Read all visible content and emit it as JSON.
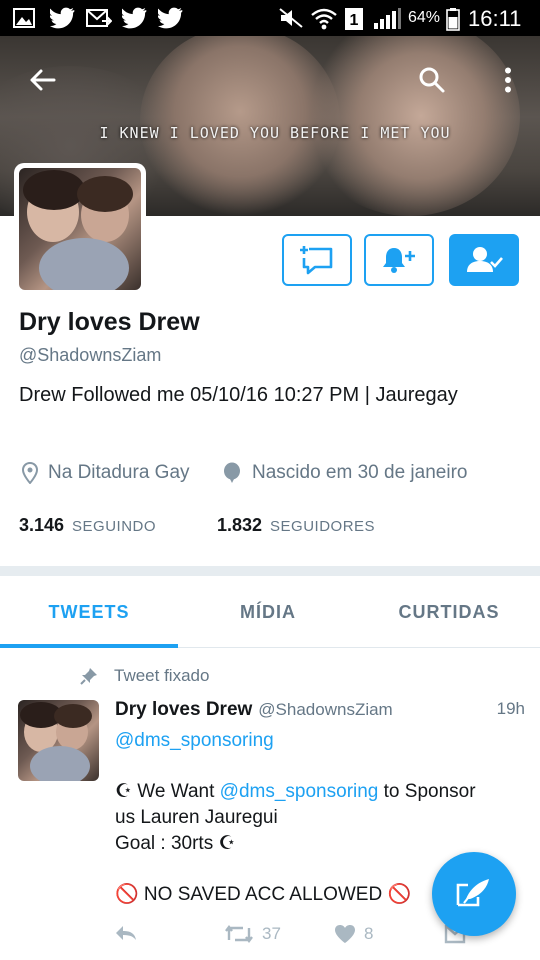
{
  "status_bar": {
    "battery_percent": "64%",
    "clock": "16:11"
  },
  "header": {
    "tagline": "I KNEW I LOVED YOU BEFORE I MET YOU"
  },
  "profile": {
    "display_name": "Dry loves Drew",
    "handle": "@ShadownsZiam",
    "bio": "Drew Followed me 05/10/16 10:27 PM | Jauregay",
    "location": "Na Ditadura Gay",
    "birthday": "Nascido em 30 de janeiro",
    "following_count": "3.146",
    "following_label": "SEGUINDO",
    "followers_count": "1.832",
    "followers_label": "SEGUIDORES"
  },
  "tabs": [
    {
      "label": "TWEETS",
      "active": true
    },
    {
      "label": "MÍDIA",
      "active": false
    },
    {
      "label": "CURTIDAS",
      "active": false
    }
  ],
  "tweet": {
    "pinned_label": "Tweet fixado",
    "author_name": "Dry loves Drew",
    "author_handle": "@ShadownsZiam",
    "time": "19h",
    "reply_to": "@dms_sponsoring",
    "line1_prefix": "☪ We Want ",
    "line1_mention": "@dms_sponsoring",
    "line1_suffix": " to Sponsor",
    "line2": "us Lauren Jauregui",
    "line3": "Goal : 30rts ☪",
    "line4": "🚫 NO SAVED ACC ALLOWED 🚫",
    "retweets": "37",
    "likes": "8"
  },
  "colors": {
    "accent": "#1da1f2",
    "secondary_text": "#657786"
  }
}
